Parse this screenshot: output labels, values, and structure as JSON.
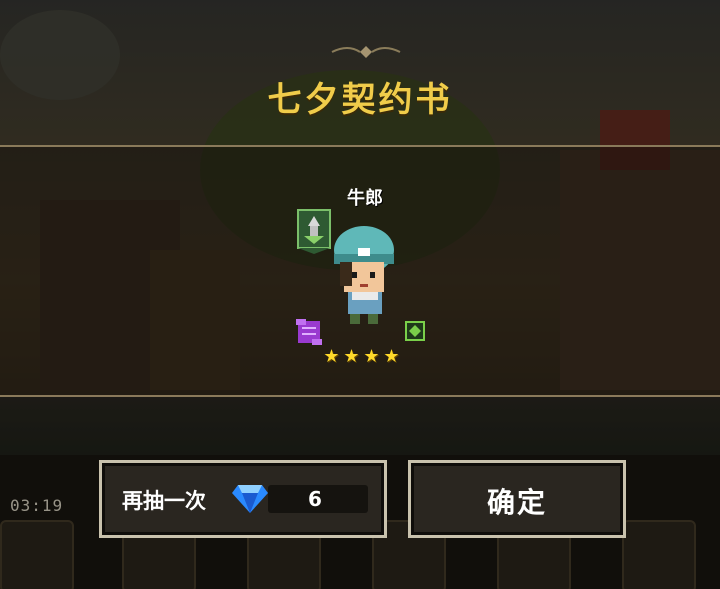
{
  "header": {
    "title": "七夕契约书"
  },
  "reward": {
    "hero_name": "牛郎",
    "stars": [
      "★",
      "★",
      "★",
      "★"
    ],
    "star_count": 4
  },
  "buttons": {
    "draw_again_label": "再抽一次",
    "draw_again_cost": "6",
    "confirm_label": "确定"
  },
  "hud": {
    "timer": "03:19"
  },
  "colors": {
    "title": "#f0cc4a",
    "star": "#ffd92a",
    "button_border": "#c9c2ad",
    "hero_hat": "#5fb8b8"
  },
  "icons": [
    "flourish-icon",
    "shield-emblem-icon",
    "purple-scroll-icon",
    "green-gem-icon",
    "diamond-icon",
    "star-icon"
  ]
}
